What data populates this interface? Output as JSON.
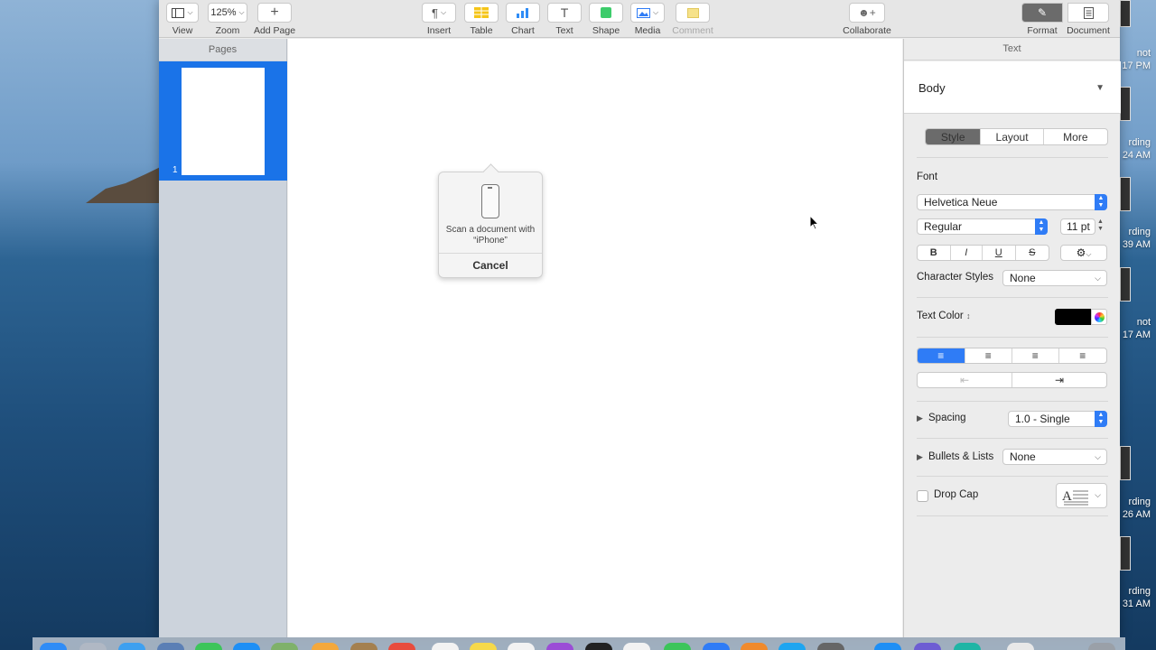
{
  "desktop": {
    "right_labels": [
      "not",
      "17 PM",
      "rding",
      "24 AM",
      "rding",
      "39 AM",
      "not",
      "17 AM",
      "rding",
      "26 AM",
      "rding",
      "31 AM"
    ]
  },
  "toolbar": {
    "view_label": "View",
    "zoom_value": "125%",
    "zoom_label": "Zoom",
    "add_page_label": "Add Page",
    "insert_label": "Insert",
    "table_label": "Table",
    "chart_label": "Chart",
    "text_label": "Text",
    "shape_label": "Shape",
    "media_label": "Media",
    "comment_label": "Comment",
    "collaborate_label": "Collaborate",
    "format_label": "Format",
    "document_label": "Document"
  },
  "sidebar": {
    "title": "Pages",
    "pages": [
      {
        "number": "1"
      }
    ]
  },
  "popover": {
    "message": "Scan a document with “iPhone”",
    "cancel_label": "Cancel"
  },
  "inspector": {
    "title": "Text",
    "paragraph_style": "Body",
    "tabs": [
      "Style",
      "Layout",
      "More"
    ],
    "font_section_label": "Font",
    "font_family": "Helvetica Neue",
    "font_typeface": "Regular",
    "font_size": "11 pt",
    "format_buttons": [
      "B",
      "I",
      "U",
      "S"
    ],
    "character_styles_label": "Character Styles",
    "character_styles_value": "None",
    "text_color_label": "Text Color",
    "text_color_value": "#000000",
    "spacing_label": "Spacing",
    "spacing_value": "1.0 - Single",
    "bullets_label": "Bullets & Lists",
    "bullets_value": "None",
    "drop_cap_label": "Drop Cap"
  },
  "colors": {
    "accent": "#1a73e8",
    "selected_alignment": "#2f7cf6"
  }
}
